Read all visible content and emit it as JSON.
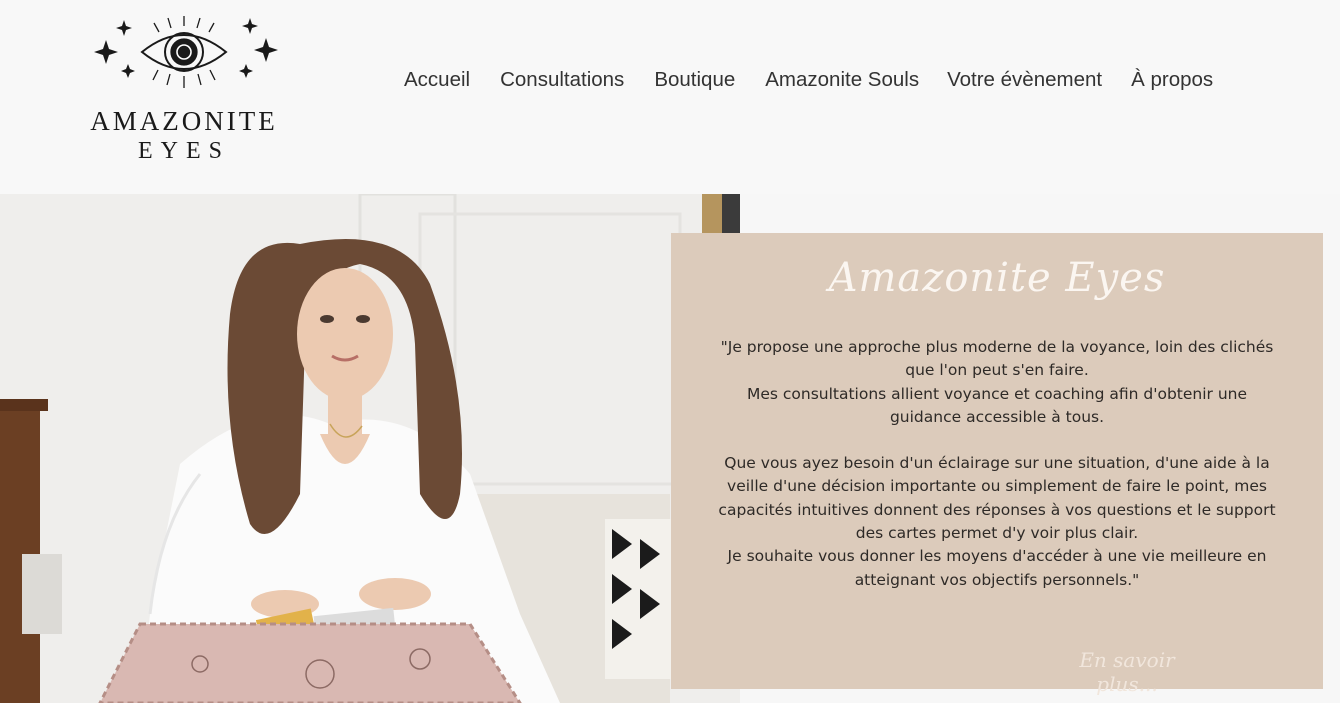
{
  "brand": {
    "line1": "AMAZONITE",
    "line2": "EYES"
  },
  "nav": {
    "items": [
      {
        "label": "Accueil"
      },
      {
        "label": "Consultations"
      },
      {
        "label": "Boutique"
      },
      {
        "label": "Amazonite Souls"
      },
      {
        "label": "Votre évènement"
      },
      {
        "label": "À propos"
      }
    ]
  },
  "hero": {
    "photo_alt": "tarot-reader-photo"
  },
  "card": {
    "title": "Amazonite Eyes",
    "paragraph1_line1": "\"Je propose une approche plus moderne de la voyance, loin des clichés que l'on peut s'en faire.",
    "paragraph1_line2": "Mes consultations allient voyance et coaching afin d'obtenir une guidance accessible à tous.",
    "paragraph2_line1": "Que vous ayez besoin d'un éclairage sur une situation, d'une aide à la veille d'une décision importante ou simplement de faire le point, mes capacités intuitives donnent des réponses à vos questions et le support des cartes permet d'y voir plus clair.",
    "paragraph2_line2": "Je souhaite vous donner les moyens d'accéder à une vie meilleure en atteignant vos objectifs personnels.\"",
    "link": "En savoir plus..."
  },
  "colors": {
    "card_bg": "#dccbbb",
    "card_title": "#fbf6f1",
    "header_bg": "#f8f8f8"
  }
}
